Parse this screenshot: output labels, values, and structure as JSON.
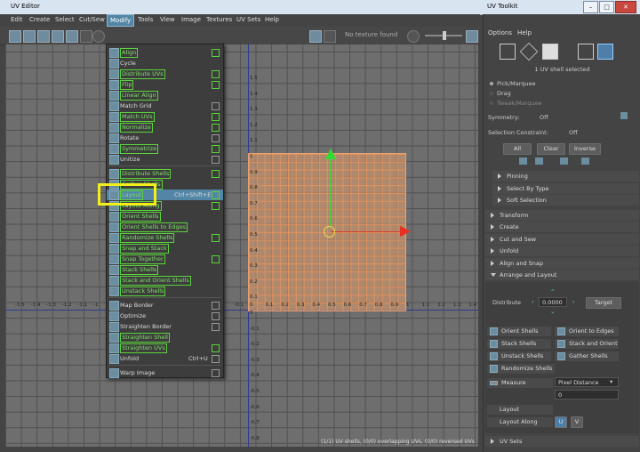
{
  "window": {
    "title": "UV Editor",
    "panel_title": "UV Toolkit"
  },
  "menubar": [
    "Edit",
    "Create",
    "Select",
    "Cut/Sew",
    "Modify",
    "Tools",
    "View",
    "Image",
    "Textures",
    "UV Sets",
    "Help"
  ],
  "toolbar": {
    "texture_status": "No texture found"
  },
  "viewport": {
    "x_ticks": [
      "-1.5",
      "-1.4",
      "-1.3",
      "-1.2",
      "-1.1",
      "-1",
      "-0.1",
      "0",
      "0.1",
      "0.2",
      "0.3",
      "0.4",
      "0.5",
      "0.6",
      "0.7",
      "0.8",
      "0.9",
      "1",
      "1.1",
      "1.2",
      "1.3",
      "1.4"
    ],
    "y_ticks": [
      "1.5",
      "1.4",
      "1.3",
      "1.2",
      "1.1",
      "1",
      "0.9",
      "0.8",
      "0.7",
      "0.6",
      "0.5",
      "0.4",
      "0.3",
      "0.2",
      "0.1",
      "0",
      "-0.1",
      "-0.2",
      "-0.3",
      "-0.4",
      "-0.5",
      "-0.6",
      "-0.7",
      "-0.8"
    ],
    "status": "(1/1) UV shells, (0/0) overlapping UVs, (0/0) reversed UVs"
  },
  "modify_menu": {
    "items": [
      {
        "label": "Align",
        "green": true,
        "box": true
      },
      {
        "label": "Cycle",
        "green": false,
        "box": false
      },
      {
        "label": "Distribute UVs",
        "green": true,
        "box": true
      },
      {
        "label": "Flip",
        "green": true,
        "box": true
      },
      {
        "label": "Linear Align",
        "green": true,
        "box": false
      },
      {
        "label": "Match Grid",
        "green": false,
        "box": true
      },
      {
        "label": "Match UVs",
        "green": true,
        "box": true
      },
      {
        "label": "Normalize",
        "green": true,
        "box": true
      },
      {
        "label": "Rotate",
        "green": false,
        "box": true
      },
      {
        "label": "Symmetrize",
        "green": true,
        "box": true
      },
      {
        "label": "Unitize",
        "green": false,
        "box": true
      },
      {
        "label": "Distribute Shells",
        "green": true,
        "box": true
      },
      {
        "label": "Gather Shells",
        "green": true,
        "box": false
      },
      {
        "label": "Layout",
        "green": true,
        "box": true,
        "shortcut": "Ctrl+Shift+E",
        "highlight": true
      },
      {
        "label": "Layout Along",
        "green": true,
        "box": true
      },
      {
        "label": "Orient Shells",
        "green": true,
        "box": false
      },
      {
        "label": "Orient Shells to Edges",
        "green": true,
        "box": false
      },
      {
        "label": "Randomize Shells",
        "green": true,
        "box": true
      },
      {
        "label": "Snap and Stack",
        "green": true,
        "box": false
      },
      {
        "label": "Snap Together",
        "green": true,
        "box": true
      },
      {
        "label": "Stack Shells",
        "green": true,
        "box": false
      },
      {
        "label": "Stack and Orient Shells",
        "green": true,
        "box": false
      },
      {
        "label": "Unstack Shells",
        "green": true,
        "box": false
      },
      {
        "label": "Map Border",
        "green": false,
        "box": true
      },
      {
        "label": "Optimize",
        "green": false,
        "box": true
      },
      {
        "label": "Straighten Border",
        "green": false,
        "box": true
      },
      {
        "label": "Straighten Shell",
        "green": true,
        "box": false
      },
      {
        "label": "Straighten UVs",
        "green": true,
        "box": true
      },
      {
        "label": "Unfold",
        "green": false,
        "box": true,
        "shortcut": "Ctrl+U"
      },
      {
        "label": "Warp Image",
        "green": false,
        "box": true
      }
    ]
  },
  "toolkit": {
    "menu": [
      "Options",
      "Help"
    ],
    "selection_hint": "1 UV shell selected",
    "modes": [
      "Pick/Marquee",
      "Drag",
      "Tweak/Marquee"
    ],
    "symmetry_label": "Symmetry:",
    "symmetry_value": "Off",
    "constraint_label": "Selection Constraint:",
    "constraint_value": "Off",
    "select_buttons": [
      "All",
      "Clear",
      "Inverse"
    ],
    "sub_sections": [
      "Pinning",
      "Select By Type",
      "Soft Selection"
    ],
    "sections": [
      "Transform",
      "Create",
      "Cut and Sew",
      "Unfold",
      "Align and Snap",
      "Arrange and Layout"
    ],
    "distribute_label": "Distribute",
    "distribute_value": "0.0000",
    "target_label": "Target",
    "shell_buttons": [
      "Orient Shells",
      "Orient to Edges",
      "Stack Shells",
      "Stack and Orient",
      "Unstack Shells",
      "Gather Shells",
      "Randomize Shells"
    ],
    "measure_label": "Measure",
    "measure_value": "Pixel Distance",
    "measure_result": "0",
    "layout_label": "Layout",
    "layout_along_label": "Layout Along",
    "u_label": "U",
    "v_label": "V",
    "uv_sets_label": "UV Sets"
  }
}
